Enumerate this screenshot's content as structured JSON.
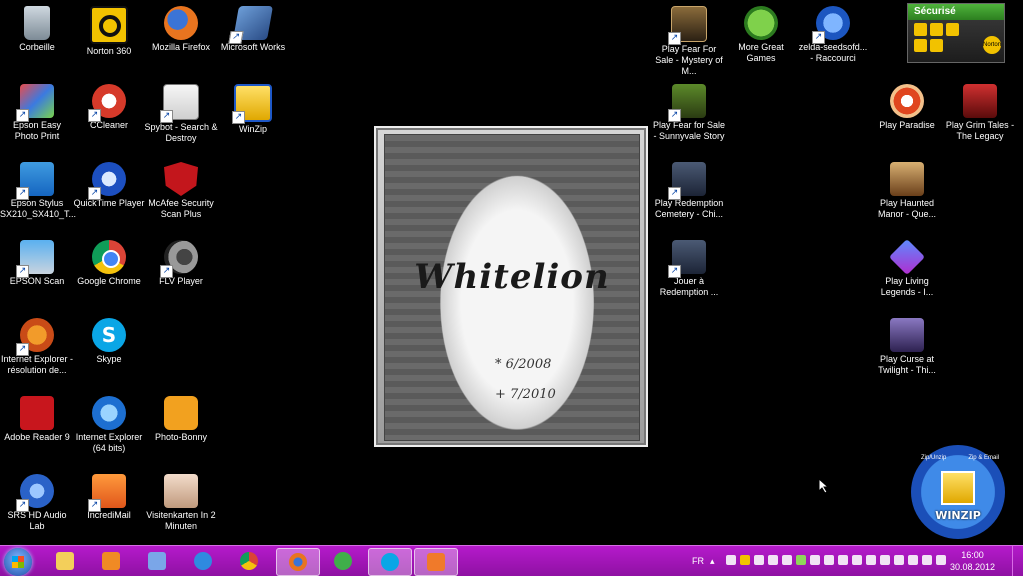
{
  "desktop": {
    "icons_left": [
      {
        "label": "Corbeille",
        "icon": "recycle-bin-icon"
      },
      {
        "label": "Norton 360",
        "icon": "norton-icon"
      },
      {
        "label": "Mozilla Firefox",
        "icon": "firefox-icon"
      },
      {
        "label": "Microsoft Works",
        "icon": "works-icon"
      },
      {
        "label": "Epson Easy Photo Print",
        "icon": "epson-photo-icon"
      },
      {
        "label": "CCleaner",
        "icon": "ccleaner-icon"
      },
      {
        "label": "Spybot - Search & Destroy",
        "icon": "spybot-icon"
      },
      {
        "label": "WinZip",
        "icon": "winzip-icon"
      },
      {
        "label": "Epson Stylus SX210_SX410_T...",
        "icon": "epson-stylus-icon"
      },
      {
        "label": "QuickTime Player",
        "icon": "quicktime-icon"
      },
      {
        "label": "McAfee Security Scan Plus",
        "icon": "mcafee-icon"
      },
      {
        "label": "EPSON Scan",
        "icon": "epson-scan-icon"
      },
      {
        "label": "Google Chrome",
        "icon": "chrome-icon"
      },
      {
        "label": "FLV Player",
        "icon": "flv-player-icon"
      },
      {
        "label": "Internet Explorer - résolution de...",
        "icon": "ie-troubleshoot-icon"
      },
      {
        "label": "Skype",
        "icon": "skype-icon"
      },
      {
        "label": "Adobe Reader 9",
        "icon": "adobe-reader-icon"
      },
      {
        "label": "Internet Explorer (64 bits)",
        "icon": "internet-explorer-icon"
      },
      {
        "label": "Photo-Bonny",
        "icon": "photo-bonny-icon"
      },
      {
        "label": "SRS HD Audio Lab",
        "icon": "srs-audio-icon"
      },
      {
        "label": "IncrediMail",
        "icon": "incredimail-icon"
      },
      {
        "label": "Visitenkarten In 2 Minuten",
        "icon": "visitenkarten-icon"
      }
    ],
    "icons_right": [
      {
        "label": "Play Fear For Sale - Mystery of M...",
        "icon": "game-fear-icon"
      },
      {
        "label": "More Great Games",
        "icon": "more-games-icon"
      },
      {
        "label": "zelda-seedsofd... - Raccourci",
        "icon": "flash-icon"
      },
      {
        "label": "Play Fear for Sale - Sunnyvale Story",
        "icon": "game-fear2-icon"
      },
      {
        "label": "Play Paradise",
        "icon": "game-paradise-icon"
      },
      {
        "label": "Play Grim Tales - The Legacy",
        "icon": "game-grim-icon"
      },
      {
        "label": "Play Redemption Cemetery - Chi...",
        "icon": "game-redemption-icon"
      },
      {
        "label": "Play Haunted Manor - Que...",
        "icon": "game-haunted-icon"
      },
      {
        "label": "Jouer à Redemption ...",
        "icon": "game-redemption2-icon"
      },
      {
        "label": "Play Living Legends - I...",
        "icon": "game-living-icon"
      },
      {
        "label": "Play Curse at Twilight - Thi...",
        "icon": "game-curse-icon"
      }
    ],
    "wallpaper": {
      "title": "Whitelion",
      "date1": "* 6/2008",
      "date2": "+ 7/2010"
    },
    "norton_widget": {
      "status": "Sécurisé",
      "logo": "Norton"
    },
    "winzip_widget": {
      "label": "WINZIP",
      "tag1": "Zip/Unzip",
      "tag2": "Zip & Email"
    }
  },
  "taskbar": {
    "language": "FR",
    "time": "16:00",
    "date": "30.08.2012",
    "pinned": [
      "explorer-icon",
      "media-player-icon",
      "paint-icon",
      "internet-explorer-icon",
      "chrome-icon",
      "firefox-icon",
      "network-icon",
      "skype-icon",
      "incredimail-icon"
    ],
    "active_index": 5
  },
  "colors": {
    "taskbar": "#9f14b5",
    "desktop": "#000000",
    "norton_green": "#3fa32f"
  }
}
